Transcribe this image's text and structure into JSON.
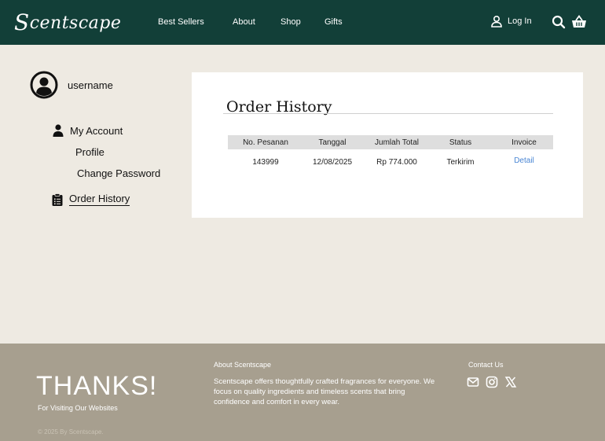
{
  "header": {
    "logo": "Scentscape",
    "nav": [
      "Best Sellers",
      "About",
      "Shop",
      "Gifts"
    ],
    "login_label": "Log In"
  },
  "sidebar": {
    "username": "username",
    "my_account": "My Account",
    "profile": "Profile",
    "change_password": "Change Password",
    "order_history": "Order History"
  },
  "main": {
    "title": "Order History",
    "columns": [
      "No. Pesanan",
      "Tanggal",
      "Jumlah Total",
      "Status",
      "Invoice"
    ],
    "rows": [
      {
        "order_no": "143999",
        "date": "12/08/2025",
        "total": "Rp 774.000",
        "status": "Terkirim",
        "invoice": "Detail"
      }
    ]
  },
  "footer": {
    "thanks": "THANKS!",
    "visit": "For Visiting Our Websites",
    "copyright": "© 2025 By Scentscape.",
    "about_heading": "About Scentscape",
    "about_text": "Scentscape offers thoughtfully crafted fragrances for everyone. We focus on quality ingredients and timeless scents that bring confidence and comfort in every wear.",
    "contact_heading": "Contact Us"
  },
  "colors": {
    "header_bg": "#123f38",
    "page_bg": "#eeeae2",
    "footer_bg": "#a79f8f",
    "link": "#4a86d4"
  }
}
